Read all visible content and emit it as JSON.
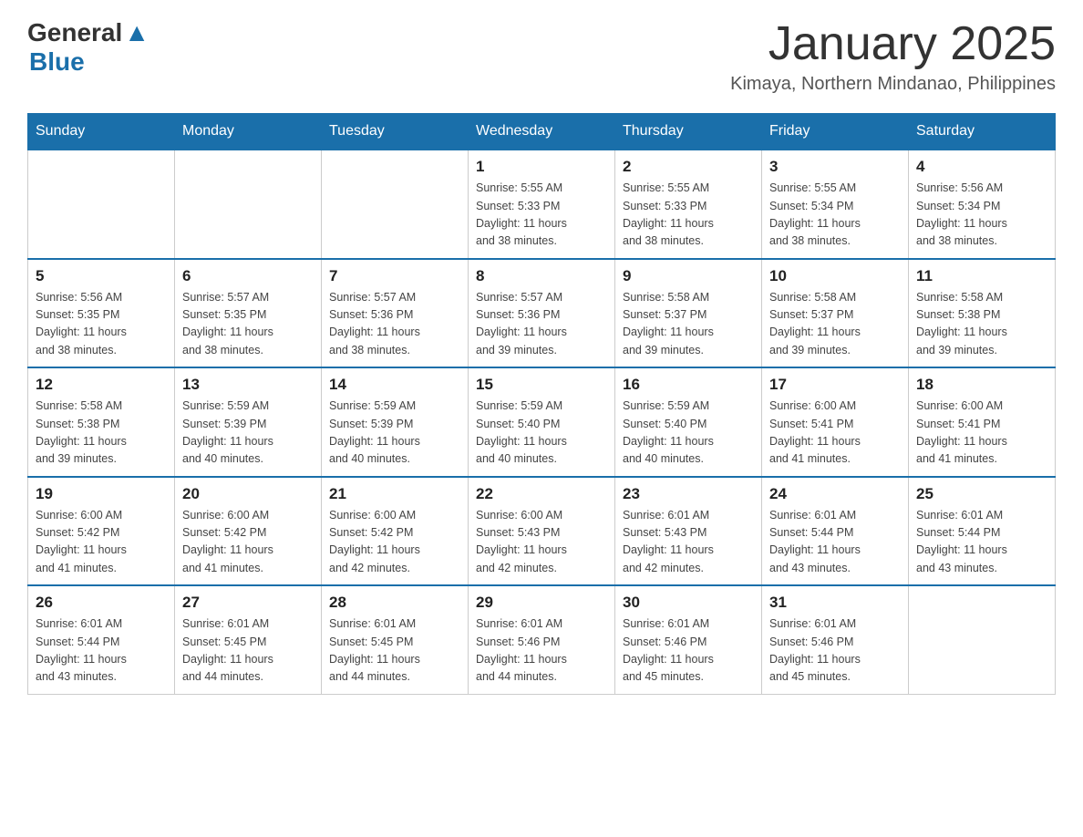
{
  "header": {
    "logo_general": "General",
    "logo_blue": "Blue",
    "month_year": "January 2025",
    "location": "Kimaya, Northern Mindanao, Philippines"
  },
  "days_of_week": [
    "Sunday",
    "Monday",
    "Tuesday",
    "Wednesday",
    "Thursday",
    "Friday",
    "Saturday"
  ],
  "weeks": [
    [
      {
        "day": "",
        "info": ""
      },
      {
        "day": "",
        "info": ""
      },
      {
        "day": "",
        "info": ""
      },
      {
        "day": "1",
        "info": "Sunrise: 5:55 AM\nSunset: 5:33 PM\nDaylight: 11 hours\nand 38 minutes."
      },
      {
        "day": "2",
        "info": "Sunrise: 5:55 AM\nSunset: 5:33 PM\nDaylight: 11 hours\nand 38 minutes."
      },
      {
        "day": "3",
        "info": "Sunrise: 5:55 AM\nSunset: 5:34 PM\nDaylight: 11 hours\nand 38 minutes."
      },
      {
        "day": "4",
        "info": "Sunrise: 5:56 AM\nSunset: 5:34 PM\nDaylight: 11 hours\nand 38 minutes."
      }
    ],
    [
      {
        "day": "5",
        "info": "Sunrise: 5:56 AM\nSunset: 5:35 PM\nDaylight: 11 hours\nand 38 minutes."
      },
      {
        "day": "6",
        "info": "Sunrise: 5:57 AM\nSunset: 5:35 PM\nDaylight: 11 hours\nand 38 minutes."
      },
      {
        "day": "7",
        "info": "Sunrise: 5:57 AM\nSunset: 5:36 PM\nDaylight: 11 hours\nand 38 minutes."
      },
      {
        "day": "8",
        "info": "Sunrise: 5:57 AM\nSunset: 5:36 PM\nDaylight: 11 hours\nand 39 minutes."
      },
      {
        "day": "9",
        "info": "Sunrise: 5:58 AM\nSunset: 5:37 PM\nDaylight: 11 hours\nand 39 minutes."
      },
      {
        "day": "10",
        "info": "Sunrise: 5:58 AM\nSunset: 5:37 PM\nDaylight: 11 hours\nand 39 minutes."
      },
      {
        "day": "11",
        "info": "Sunrise: 5:58 AM\nSunset: 5:38 PM\nDaylight: 11 hours\nand 39 minutes."
      }
    ],
    [
      {
        "day": "12",
        "info": "Sunrise: 5:58 AM\nSunset: 5:38 PM\nDaylight: 11 hours\nand 39 minutes."
      },
      {
        "day": "13",
        "info": "Sunrise: 5:59 AM\nSunset: 5:39 PM\nDaylight: 11 hours\nand 40 minutes."
      },
      {
        "day": "14",
        "info": "Sunrise: 5:59 AM\nSunset: 5:39 PM\nDaylight: 11 hours\nand 40 minutes."
      },
      {
        "day": "15",
        "info": "Sunrise: 5:59 AM\nSunset: 5:40 PM\nDaylight: 11 hours\nand 40 minutes."
      },
      {
        "day": "16",
        "info": "Sunrise: 5:59 AM\nSunset: 5:40 PM\nDaylight: 11 hours\nand 40 minutes."
      },
      {
        "day": "17",
        "info": "Sunrise: 6:00 AM\nSunset: 5:41 PM\nDaylight: 11 hours\nand 41 minutes."
      },
      {
        "day": "18",
        "info": "Sunrise: 6:00 AM\nSunset: 5:41 PM\nDaylight: 11 hours\nand 41 minutes."
      }
    ],
    [
      {
        "day": "19",
        "info": "Sunrise: 6:00 AM\nSunset: 5:42 PM\nDaylight: 11 hours\nand 41 minutes."
      },
      {
        "day": "20",
        "info": "Sunrise: 6:00 AM\nSunset: 5:42 PM\nDaylight: 11 hours\nand 41 minutes."
      },
      {
        "day": "21",
        "info": "Sunrise: 6:00 AM\nSunset: 5:42 PM\nDaylight: 11 hours\nand 42 minutes."
      },
      {
        "day": "22",
        "info": "Sunrise: 6:00 AM\nSunset: 5:43 PM\nDaylight: 11 hours\nand 42 minutes."
      },
      {
        "day": "23",
        "info": "Sunrise: 6:01 AM\nSunset: 5:43 PM\nDaylight: 11 hours\nand 42 minutes."
      },
      {
        "day": "24",
        "info": "Sunrise: 6:01 AM\nSunset: 5:44 PM\nDaylight: 11 hours\nand 43 minutes."
      },
      {
        "day": "25",
        "info": "Sunrise: 6:01 AM\nSunset: 5:44 PM\nDaylight: 11 hours\nand 43 minutes."
      }
    ],
    [
      {
        "day": "26",
        "info": "Sunrise: 6:01 AM\nSunset: 5:44 PM\nDaylight: 11 hours\nand 43 minutes."
      },
      {
        "day": "27",
        "info": "Sunrise: 6:01 AM\nSunset: 5:45 PM\nDaylight: 11 hours\nand 44 minutes."
      },
      {
        "day": "28",
        "info": "Sunrise: 6:01 AM\nSunset: 5:45 PM\nDaylight: 11 hours\nand 44 minutes."
      },
      {
        "day": "29",
        "info": "Sunrise: 6:01 AM\nSunset: 5:46 PM\nDaylight: 11 hours\nand 44 minutes."
      },
      {
        "day": "30",
        "info": "Sunrise: 6:01 AM\nSunset: 5:46 PM\nDaylight: 11 hours\nand 45 minutes."
      },
      {
        "day": "31",
        "info": "Sunrise: 6:01 AM\nSunset: 5:46 PM\nDaylight: 11 hours\nand 45 minutes."
      },
      {
        "day": "",
        "info": ""
      }
    ]
  ]
}
